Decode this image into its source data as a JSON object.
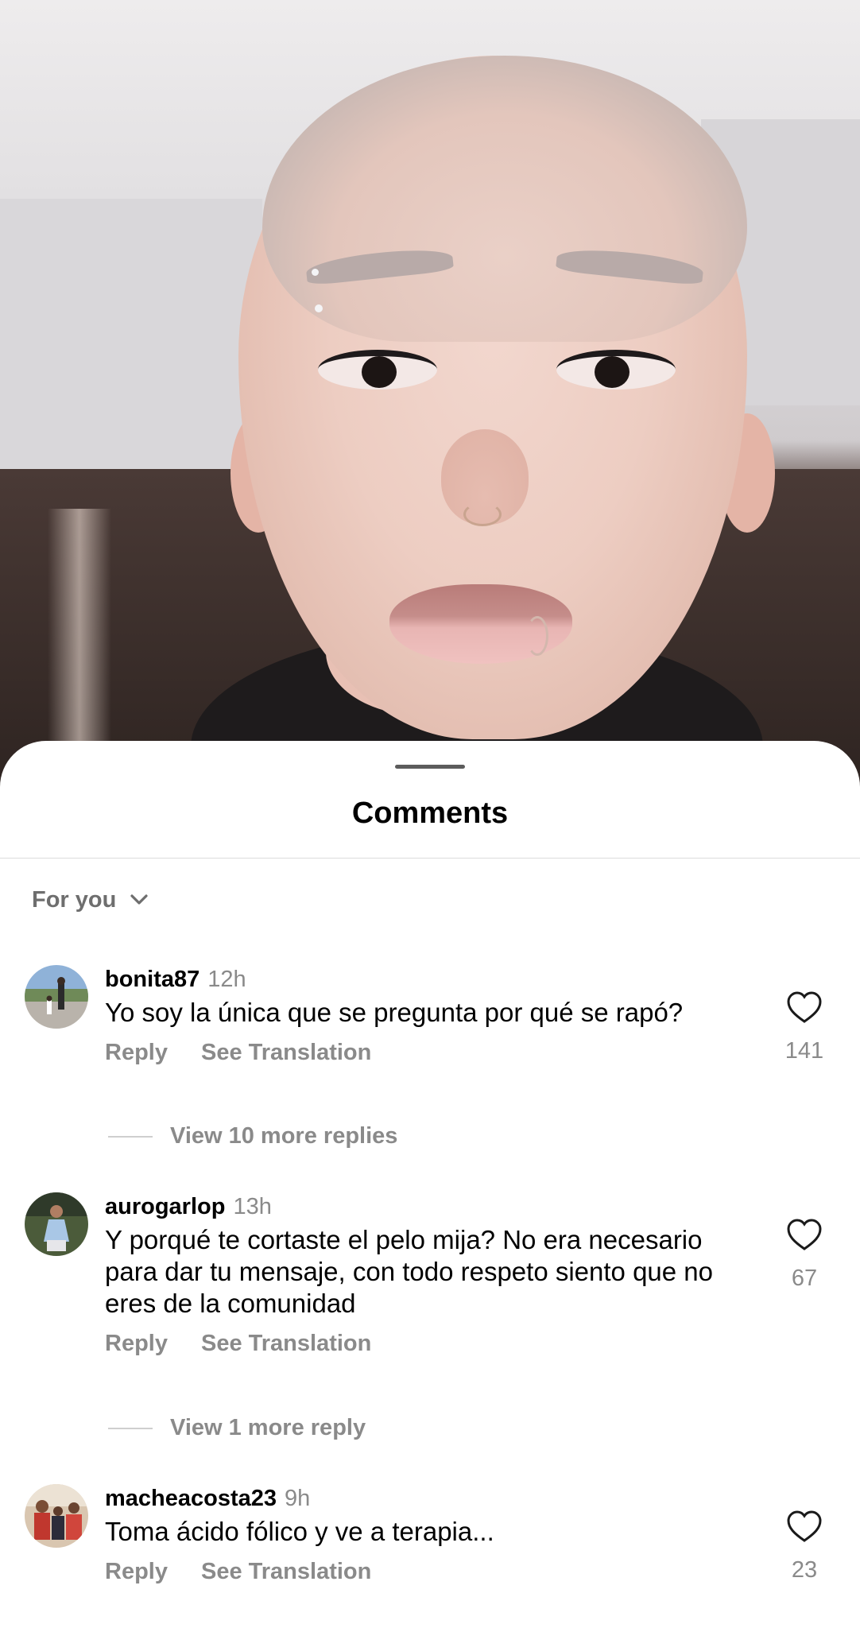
{
  "sheet": {
    "title": "Comments",
    "sort_label": "For you"
  },
  "comments": [
    {
      "username": "bonita87",
      "time": "12h",
      "text": "Yo soy la única que se pregunta por qué se rapó?",
      "reply_label": "Reply",
      "translate_label": "See Translation",
      "likes": "141",
      "more_replies": "View 10 more replies"
    },
    {
      "username": "aurogarlop",
      "time": "13h",
      "text": "Y porqué te cortaste el pelo mija? No era necesario para dar tu mensaje, con todo respeto siento que no eres de la comunidad",
      "reply_label": "Reply",
      "translate_label": "See Translation",
      "likes": "67",
      "more_replies": "View 1 more reply"
    },
    {
      "username": "macheacosta23",
      "time": "9h",
      "text": "Toma ácido fólico y ve a terapia...",
      "reply_label": "Reply",
      "translate_label": "See Translation",
      "likes": "23"
    }
  ],
  "icons": {
    "sort": "chevron-down-icon",
    "like": "heart-outline-icon"
  },
  "colors": {
    "secondary_text": "#8a8a8a",
    "divider": "#dcdcdc"
  }
}
